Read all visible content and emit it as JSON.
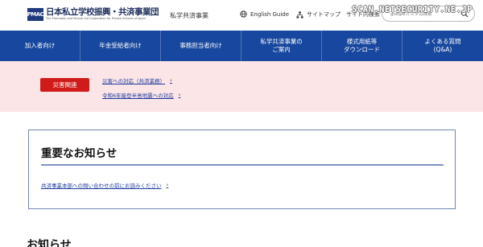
{
  "header": {
    "logo_mark": "PMAC",
    "logo_main": "日本私立学校振興・共済事業団",
    "logo_sub": "The Promotion and Mutual Aid Corporation for Private Schools of Japan",
    "site_name": "私学共済事業",
    "english_label": "English Guide",
    "sitemap_label": "サイトマップ",
    "site_search_label": "サイト内検索",
    "search_placeholder": "googleカスタム検索",
    "watermark": "SCAN.NETSECURITY.NE.JP"
  },
  "nav": {
    "items": [
      {
        "label": "加入者向け"
      },
      {
        "label": "年金受給者向け"
      },
      {
        "label": "事務担当者向け"
      },
      {
        "label": "私学共済事業の\nご案内"
      },
      {
        "label": "様式用紙等\nダウンロード"
      },
      {
        "label": "よくある質問\n(Q&A)"
      }
    ]
  },
  "disaster": {
    "badge": "災害関連",
    "links": [
      {
        "label": "災害への対応（共済業務）"
      },
      {
        "label": "令和6年能登半島地震への対応"
      }
    ]
  },
  "notice": {
    "title": "重要なお知らせ",
    "link": "共済事業本部への問い合わせの前にお読みください"
  },
  "news": {
    "title": "お知らせ"
  },
  "colors": {
    "nav_bg": "#17479e",
    "disaster_bg": "#fbe5e6",
    "badge_bg": "#d11b1b",
    "link": "#1f3b9e"
  }
}
